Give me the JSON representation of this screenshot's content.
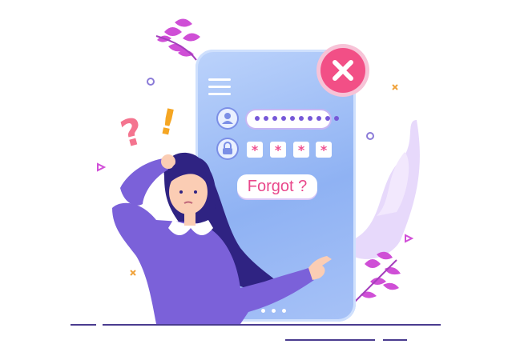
{
  "illustration": {
    "subject": "forgot password",
    "colors": {
      "phone": "#9fbdf6",
      "accent_pink": "#f24f86",
      "purple": "#7658d8",
      "leaf_pink": "#d14fd8",
      "hair": "#3a2a8e",
      "skin": "#fbcdb4"
    }
  },
  "login_form": {
    "username_mask": "●●●●●●●●",
    "pin_digits": [
      "*",
      "*",
      "*",
      "*"
    ],
    "forgot_label": "Forgot ?",
    "username_icon": "user-icon",
    "password_icon": "lock-icon",
    "menu_icon": "hamburger-menu-icon",
    "error_icon": "close-x-icon",
    "page_indicator_count": 3
  }
}
